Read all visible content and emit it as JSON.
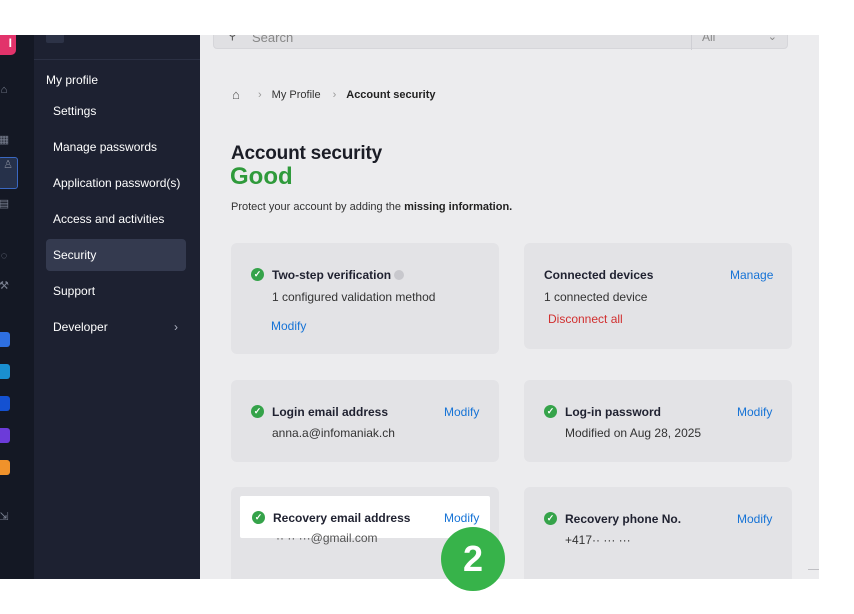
{
  "window": {
    "accent": "#37b34a",
    "link_color": "#1673d6"
  },
  "rail": {
    "brand_label": "I",
    "icons": [
      "home-icon",
      "calculator-icon",
      "users-icon",
      "id-card-icon",
      "support-icon",
      "tools-icon",
      "logout-icon"
    ],
    "apps": [
      {
        "name": "app-icon-1",
        "color": "#2e6fe0"
      },
      {
        "name": "app-icon-2",
        "color": "#1a8fd0"
      },
      {
        "name": "app-icon-3",
        "color": "#1451d1"
      },
      {
        "name": "app-icon-4",
        "color": "#6c3bd9"
      },
      {
        "name": "app-icon-5",
        "color": "#f0922b"
      }
    ]
  },
  "menu": {
    "heading": "My profile",
    "items": [
      {
        "label": "Settings"
      },
      {
        "label": "Manage passwords"
      },
      {
        "label": "Application password(s)"
      },
      {
        "label": "Access and activities"
      },
      {
        "label": "Security",
        "active": true
      },
      {
        "label": "Support"
      },
      {
        "label": "Developer",
        "has_submenu": true
      }
    ]
  },
  "search": {
    "placeholder": "Search",
    "scope": "All"
  },
  "breadcrumb": {
    "level1": "My Profile",
    "current": "Account security"
  },
  "page": {
    "title": "Account security",
    "status": "Good",
    "description_prefix": "Protect your account by adding the ",
    "description_bold": "missing information."
  },
  "cards": {
    "two_step": {
      "title": "Two-step verification",
      "subtitle": "1 configured validation method",
      "action": "Modify"
    },
    "devices": {
      "title": "Connected devices",
      "subtitle": "1 connected device",
      "action": "Manage",
      "danger_action": "Disconnect all"
    },
    "login_email": {
      "title": "Login email address",
      "value": "anna.a@infomaniak.ch",
      "action": "Modify"
    },
    "password": {
      "title": "Log-in password",
      "value": "Modified on Aug 28, 2025",
      "action": "Modify"
    },
    "recovery_email": {
      "title": "Recovery email address",
      "value": "·· ·· ···@gmail.com",
      "action": "Modify"
    },
    "recovery_phone": {
      "title": "Recovery phone No.",
      "value": "+417·· ··· ···",
      "action": "Modify"
    }
  },
  "step_badge": "2"
}
